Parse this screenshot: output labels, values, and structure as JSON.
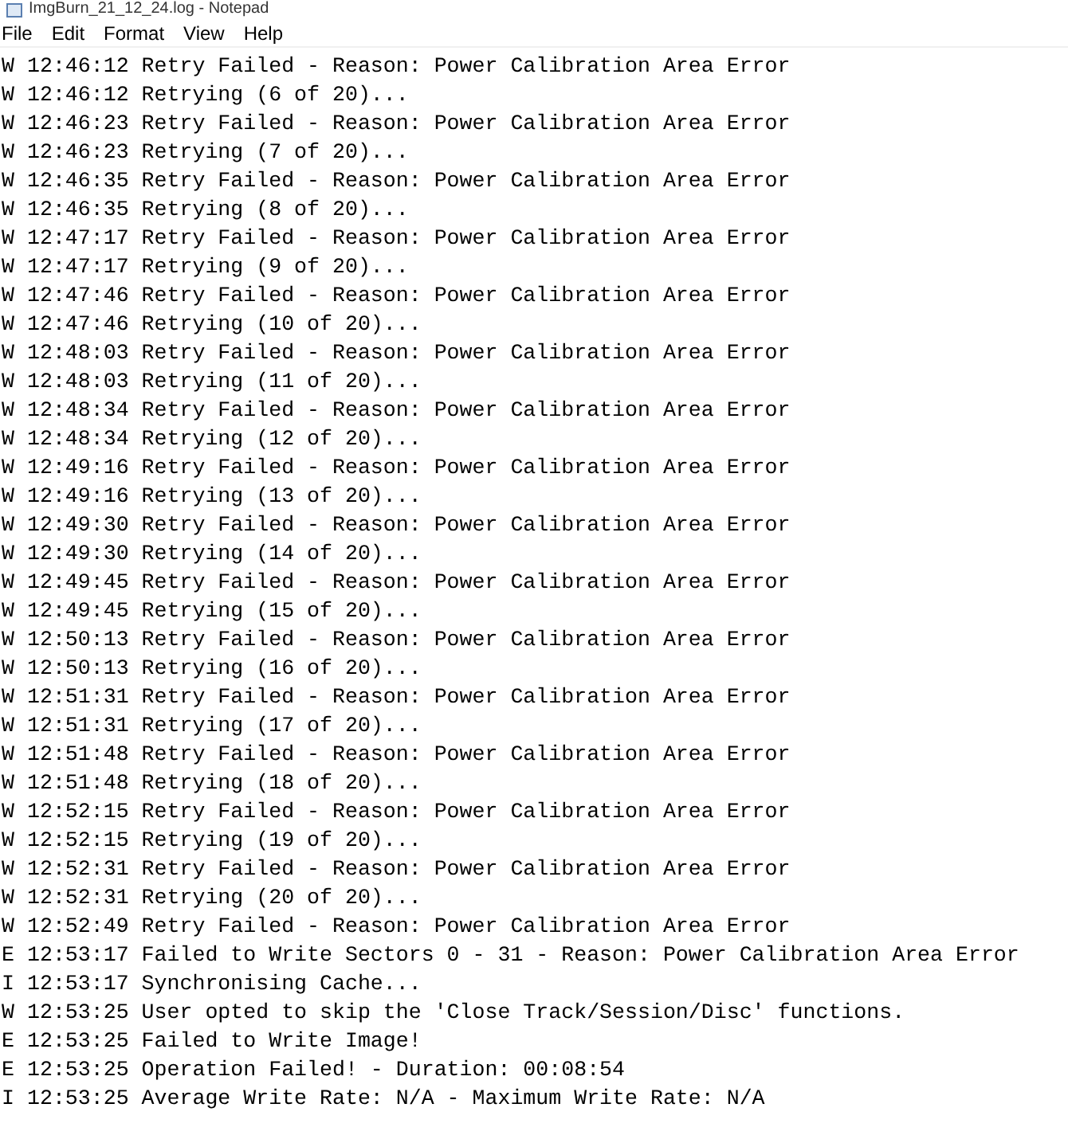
{
  "window": {
    "title": "ImgBurn_21_12_24.log - Notepad"
  },
  "menu": [
    "File",
    "Edit",
    "Format",
    "View",
    "Help"
  ],
  "lines": [
    {
      "level": "W",
      "text": "12:46:12 Retry Failed - Reason: Power Calibration Area Error"
    },
    {
      "level": "W",
      "text": "12:46:12 Retrying (6 of 20)..."
    },
    {
      "level": "W",
      "text": "12:46:23 Retry Failed - Reason: Power Calibration Area Error"
    },
    {
      "level": "W",
      "text": "12:46:23 Retrying (7 of 20)..."
    },
    {
      "level": "W",
      "text": "12:46:35 Retry Failed - Reason: Power Calibration Area Error"
    },
    {
      "level": "W",
      "text": "12:46:35 Retrying (8 of 20)..."
    },
    {
      "level": "W",
      "text": "12:47:17 Retry Failed - Reason: Power Calibration Area Error"
    },
    {
      "level": "W",
      "text": "12:47:17 Retrying (9 of 20)..."
    },
    {
      "level": "W",
      "text": "12:47:46 Retry Failed - Reason: Power Calibration Area Error"
    },
    {
      "level": "W",
      "text": "12:47:46 Retrying (10 of 20)..."
    },
    {
      "level": "W",
      "text": "12:48:03 Retry Failed - Reason: Power Calibration Area Error"
    },
    {
      "level": "W",
      "text": "12:48:03 Retrying (11 of 20)..."
    },
    {
      "level": "W",
      "text": "12:48:34 Retry Failed - Reason: Power Calibration Area Error"
    },
    {
      "level": "W",
      "text": "12:48:34 Retrying (12 of 20)..."
    },
    {
      "level": "W",
      "text": "12:49:16 Retry Failed - Reason: Power Calibration Area Error"
    },
    {
      "level": "W",
      "text": "12:49:16 Retrying (13 of 20)..."
    },
    {
      "level": "W",
      "text": "12:49:30 Retry Failed - Reason: Power Calibration Area Error"
    },
    {
      "level": "W",
      "text": "12:49:30 Retrying (14 of 20)..."
    },
    {
      "level": "W",
      "text": "12:49:45 Retry Failed - Reason: Power Calibration Area Error"
    },
    {
      "level": "W",
      "text": "12:49:45 Retrying (15 of 20)..."
    },
    {
      "level": "W",
      "text": "12:50:13 Retry Failed - Reason: Power Calibration Area Error"
    },
    {
      "level": "W",
      "text": "12:50:13 Retrying (16 of 20)..."
    },
    {
      "level": "W",
      "text": "12:51:31 Retry Failed - Reason: Power Calibration Area Error"
    },
    {
      "level": "W",
      "text": "12:51:31 Retrying (17 of 20)..."
    },
    {
      "level": "W",
      "text": "12:51:48 Retry Failed - Reason: Power Calibration Area Error"
    },
    {
      "level": "W",
      "text": "12:51:48 Retrying (18 of 20)..."
    },
    {
      "level": "W",
      "text": "12:52:15 Retry Failed - Reason: Power Calibration Area Error"
    },
    {
      "level": "W",
      "text": "12:52:15 Retrying (19 of 20)..."
    },
    {
      "level": "W",
      "text": "12:52:31 Retry Failed - Reason: Power Calibration Area Error"
    },
    {
      "level": "W",
      "text": "12:52:31 Retrying (20 of 20)..."
    },
    {
      "level": "W",
      "text": "12:52:49 Retry Failed - Reason: Power Calibration Area Error"
    },
    {
      "level": "E",
      "text": "12:53:17 Failed to Write Sectors 0 - 31 - Reason: Power Calibration Area Error"
    },
    {
      "level": "I",
      "text": "12:53:17 Synchronising Cache..."
    },
    {
      "level": "W",
      "text": "12:53:25 User opted to skip the 'Close Track/Session/Disc' functions."
    },
    {
      "level": "E",
      "text": "12:53:25 Failed to Write Image!"
    },
    {
      "level": "E",
      "text": "12:53:25 Operation Failed! - Duration: 00:08:54"
    },
    {
      "level": "I",
      "text": "12:53:25 Average Write Rate: N/A - Maximum Write Rate: N/A"
    }
  ]
}
